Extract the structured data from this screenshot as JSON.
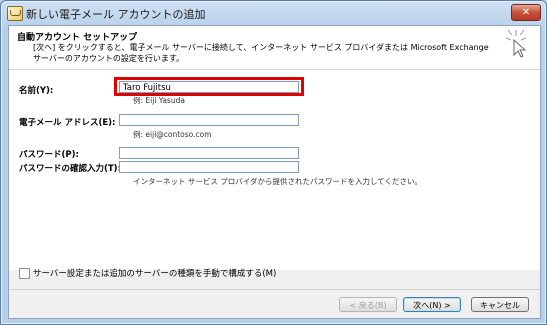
{
  "window": {
    "title": "新しい電子メール アカウントの追加",
    "close_label": "✕"
  },
  "header": {
    "title": "自動アカウント セットアップ",
    "description": "[次へ] をクリックすると、電子メール サーバーに接続して、インターネット サービス プロバイダまたは Microsoft Exchange サーバーのアカウントの設定を行います。"
  },
  "form": {
    "name_label": "名前(Y):",
    "name_value": "Taro Fujitsu",
    "name_hint": "例: Eiji Yasuda",
    "email_label": "電子メール アドレス(E):",
    "email_value": "",
    "email_hint": "例: eiji@contoso.com",
    "password_label": "パスワード(P):",
    "password_value": "",
    "confirm_label": "パスワードの確認入力(T):",
    "confirm_value": "",
    "password_hint": "インターネット サービス プロバイダから提供されたパスワードを入力してください。"
  },
  "options": {
    "manual_config_label": "サーバー設定または追加のサーバーの種類を手動で構成する(M)",
    "manual_config_checked": false
  },
  "buttons": {
    "back": "< 戻る(B)",
    "next": "次へ(N) >",
    "cancel": "キャンセル"
  },
  "colors": {
    "highlight": "#e00000",
    "accent": "#3c7fb1"
  }
}
